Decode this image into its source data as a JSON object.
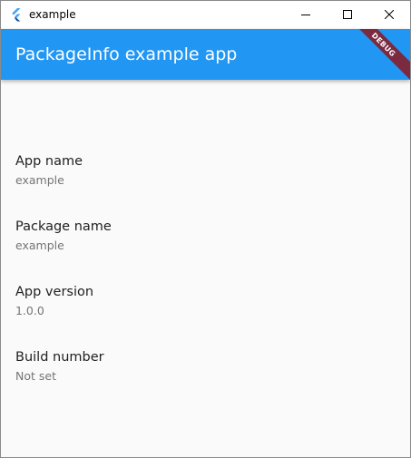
{
  "window": {
    "title": "example",
    "controls": {
      "minimize": "minimize",
      "maximize": "maximize",
      "close": "close"
    }
  },
  "appbar": {
    "title": "PackageInfo example app",
    "color": "#2196f3",
    "debug_banner": "DEBUG"
  },
  "tiles": [
    {
      "title": "App name",
      "subtitle": "example"
    },
    {
      "title": "Package name",
      "subtitle": "example"
    },
    {
      "title": "App version",
      "subtitle": "1.0.0"
    },
    {
      "title": "Build number",
      "subtitle": "Not set"
    }
  ]
}
